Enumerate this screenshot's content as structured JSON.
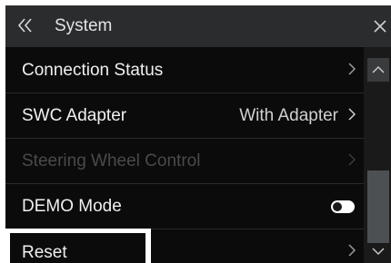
{
  "header": {
    "title": "System",
    "back_icon": "double-chevron-left-icon",
    "close_icon": "close-icon"
  },
  "list": {
    "items": [
      {
        "label": "Connection Status",
        "value": "",
        "enabled": true,
        "control": "chevron"
      },
      {
        "label": "SWC Adapter",
        "value": "With Adapter",
        "enabled": true,
        "control": "chevron"
      },
      {
        "label": "Steering Wheel Control",
        "value": "",
        "enabled": false,
        "control": "chevron"
      },
      {
        "label": "DEMO Mode",
        "value": "",
        "enabled": true,
        "control": "toggle",
        "toggle_on": true
      },
      {
        "label": "Reset",
        "value": "",
        "enabled": true,
        "control": "chevron",
        "highlighted": true
      }
    ]
  },
  "scrollbar": {
    "up_icon": "chevron-up-icon",
    "down_icon": "chevron-down-icon"
  },
  "colors": {
    "header_bg": "#2b2c2e",
    "list_bg": "#0b0b0b",
    "text": "#f0f0f0",
    "disabled_text": "#4a4a4a"
  }
}
